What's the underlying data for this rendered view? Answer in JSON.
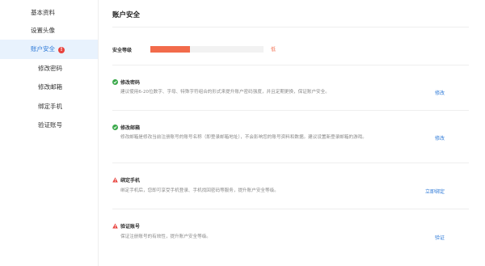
{
  "sidebar": {
    "items": [
      {
        "label": "基本资料"
      },
      {
        "label": "设置头像"
      },
      {
        "label": "账户安全",
        "badge": "!"
      },
      {
        "label": "修改密码"
      },
      {
        "label": "修改邮箱"
      },
      {
        "label": "绑定手机"
      },
      {
        "label": "验证账号"
      }
    ]
  },
  "main": {
    "title": "账户安全",
    "security_level": {
      "label": "安全等级",
      "value_text": "低",
      "fill_fraction": 0.35,
      "color": "#f26b4b"
    },
    "sections": [
      {
        "title": "修改密码",
        "status_icon": "check-circle-icon",
        "desc": "建议使用6-20位数字、字母、特殊字符组合的形式来提升账户密码强度，并且定期更换，保证账户安全。",
        "action": "修改"
      },
      {
        "title": "修改邮箱",
        "status_icon": "check-circle-icon",
        "desc": "修改邮箱是修改当前注册账号的账号名称（即登录邮箱地址），不会影响您的账号资料和数据。建议设置新登录邮箱的游戏。",
        "action": "修改"
      },
      {
        "title": "绑定手机",
        "status_icon": "warning-triangle-icon",
        "desc": "绑定手机后，您即可享受手机登录、手机找回密码等服务，提升账户安全等级。",
        "action": "立即绑定"
      },
      {
        "title": "验证账号",
        "status_icon": "warning-triangle-icon",
        "desc": "保证注册账号的有效性，提升账户安全等级。",
        "action": "验证"
      }
    ]
  },
  "colors": {
    "accent": "#2f7bd8",
    "danger": "#f26b4b",
    "ok": "#3aa94a",
    "warn": "#e8423d",
    "active_bg": "#e8f2fd"
  }
}
